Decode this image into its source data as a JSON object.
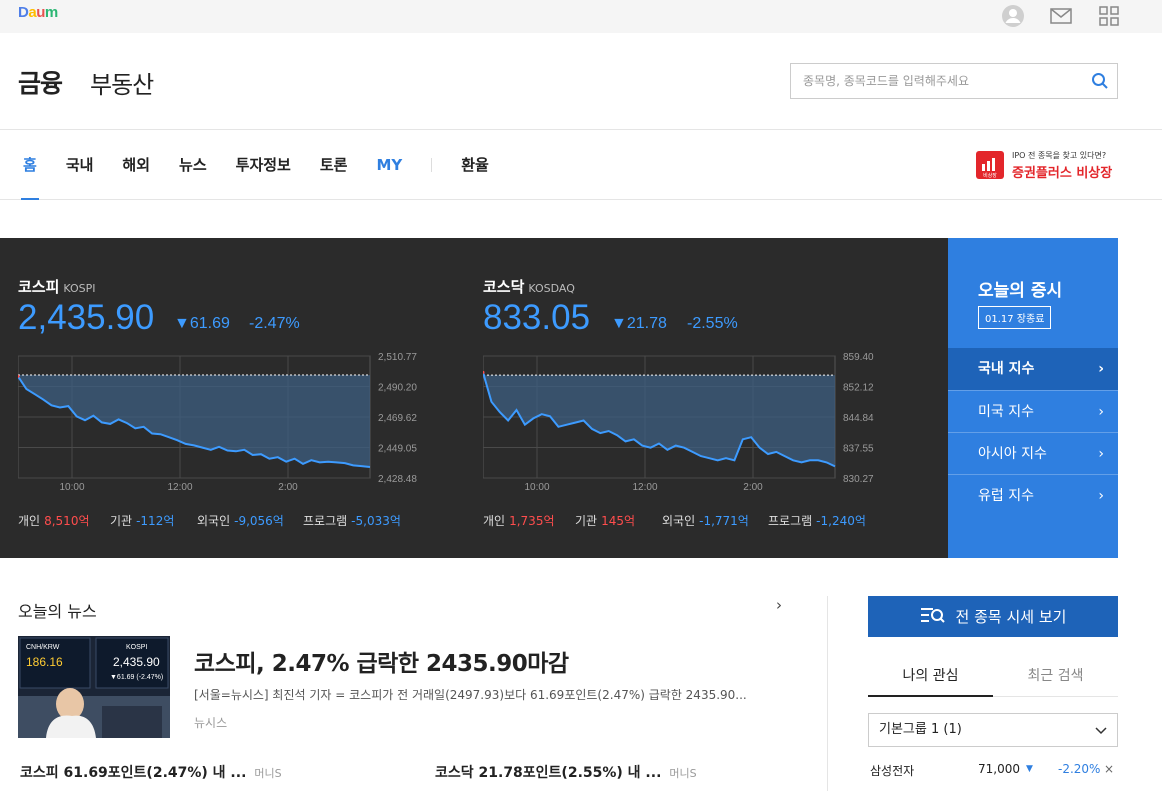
{
  "top": {
    "logo": "Daum",
    "logo_colors": [
      "#4f7fe8",
      "#ffbc00",
      "#e8524f",
      "#2bb673"
    ]
  },
  "header": {
    "title": "금융",
    "subtitle": "부동산",
    "search_placeholder": "종목명, 종목코드를 입력해주세요"
  },
  "nav": {
    "items": [
      "홈",
      "국내",
      "해외",
      "뉴스",
      "투자정보",
      "토론",
      "MY"
    ],
    "extra": "환율",
    "active": "홈",
    "ipo_small": "IPO 전 종목을 찾고 있다면?",
    "ipo_big": "증권플러스 비상장",
    "ipo_logo_text": "비상장"
  },
  "kospi": {
    "name": "코스피",
    "name_en": "KOSPI",
    "value": "2,435.90",
    "change": "▼61.69",
    "pct": "-2.47%",
    "yticks": [
      "2,510.77",
      "2,490.20",
      "2,469.62",
      "2,449.05",
      "2,428.48"
    ],
    "xticks": [
      "10:00",
      "12:00",
      "2:00"
    ],
    "investors": [
      {
        "label": "개인",
        "value": "8,510억",
        "sign": "pos"
      },
      {
        "label": "기관",
        "value": "-112억",
        "sign": "neg"
      },
      {
        "label": "외국인",
        "value": "-9,056억",
        "sign": "neg"
      },
      {
        "label": "프로그램",
        "value": "-5,033억",
        "sign": "neg"
      }
    ]
  },
  "kosdaq": {
    "name": "코스닥",
    "name_en": "KOSDAQ",
    "value": "833.05",
    "change": "▼21.78",
    "pct": "-2.55%",
    "yticks": [
      "859.40",
      "852.12",
      "844.84",
      "837.55",
      "830.27"
    ],
    "xticks": [
      "10:00",
      "12:00",
      "2:00"
    ],
    "investors": [
      {
        "label": "개인",
        "value": "1,735억",
        "sign": "pos"
      },
      {
        "label": "기관",
        "value": "145억",
        "sign": "pos"
      },
      {
        "label": "외국인",
        "value": "-1,771억",
        "sign": "neg"
      },
      {
        "label": "프로그램",
        "value": "-1,240억",
        "sign": "neg"
      }
    ]
  },
  "chart_data": [
    {
      "type": "area",
      "series_color": "#3d9bff",
      "ylim": [
        2428.48,
        2510.77
      ],
      "xlabels": [
        "10:00",
        "12:00",
        "2:00"
      ],
      "reference": 2497.93,
      "values": [
        2497.0,
        2488.5,
        2485.0,
        2481.5,
        2477.5,
        2476.0,
        2477.0,
        2470.0,
        2467.5,
        2470.5,
        2466.0,
        2465.0,
        2468.0,
        2465.5,
        2462.0,
        2463.0,
        2458.5,
        2458.0,
        2456.0,
        2454.0,
        2451.5,
        2450.5,
        2449.0,
        2447.5,
        2449.5,
        2447.0,
        2446.5,
        2447.5,
        2444.0,
        2444.5,
        2441.5,
        2442.5,
        2439.5,
        2441.5,
        2438.0,
        2440.5,
        2439.0,
        2439.5,
        2439.0,
        2438.5,
        2437.0,
        2436.5,
        2435.9
      ]
    },
    {
      "type": "area",
      "series_color": "#3d9bff",
      "ylim": [
        830.27,
        859.4
      ],
      "xlabels": [
        "10:00",
        "12:00",
        "2:00"
      ],
      "reference": 854.83,
      "values": [
        855.5,
        848.5,
        846.0,
        844.0,
        846.5,
        843.0,
        844.5,
        845.5,
        845.0,
        842.5,
        843.0,
        843.5,
        844.0,
        842.0,
        841.0,
        841.5,
        840.5,
        839.0,
        839.5,
        838.0,
        837.5,
        838.5,
        837.0,
        838.0,
        837.5,
        836.5,
        835.5,
        835.0,
        834.5,
        835.0,
        834.5,
        839.5,
        840.0,
        837.5,
        836.0,
        836.5,
        835.5,
        834.5,
        834.0,
        834.5,
        834.5,
        834.0,
        833.05
      ]
    }
  ],
  "today": {
    "title": "오늘의 증시",
    "badge": "01.17 장종료",
    "items": [
      "국내 지수",
      "미국 지수",
      "아시아 지수",
      "유럽 지수"
    ]
  },
  "news": {
    "heading": "오늘의 뉴스",
    "more": "›",
    "title": "코스피, 2.47% 급락한 2435.90마감",
    "summary": "[서울=뉴시스] 최진석 기자 = 코스피가 전 거래일(2497.93)보다 61.69포인트(2.47%) 급락한 2435.90...",
    "source": "뉴시스",
    "image_text": {
      "pair": "CNH/KRW",
      "pair_val": "186.16",
      "idx": "KOSPI",
      "idx_val": "2,435.90",
      "idx_chg": "▼61.69 (-2.47%)"
    },
    "sub": [
      {
        "title": "코스피 61.69포인트(2.47%) 내 ...",
        "source": "머니S"
      },
      {
        "title": "코스닥 21.78포인트(2.55%) 내 ...",
        "source": "머니S"
      }
    ]
  },
  "widget": {
    "all_button": "전 종목 시세 보기",
    "tabs": [
      "나의 관심",
      "최근 검색"
    ],
    "group": "기본그룹 1 (1)",
    "watch": [
      {
        "name": "삼성전자",
        "price": "71,000",
        "arrow": "▼",
        "pct": "-2.20%",
        "remove": "×"
      }
    ]
  }
}
